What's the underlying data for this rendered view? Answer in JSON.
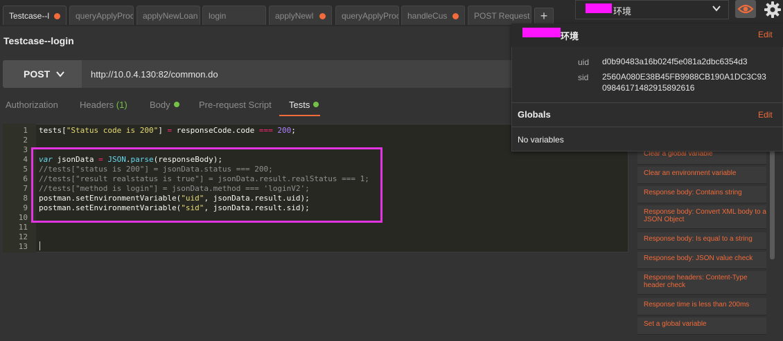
{
  "tabs": [
    {
      "label": "Testcase--l",
      "dot": true,
      "active": true
    },
    {
      "label": "queryApplyProce",
      "dot": false
    },
    {
      "label": "applyNewLoan",
      "dot": false
    },
    {
      "label": "login",
      "dot": false
    },
    {
      "label": "applyNewl",
      "dot": true
    },
    {
      "label": "queryApplyProc",
      "dot": false
    },
    {
      "label": "handleCus",
      "dot": true
    },
    {
      "label": "POST Request",
      "dot": false
    }
  ],
  "add_tab": "+",
  "environment": {
    "selected": "环境"
  },
  "request": {
    "title": "Testcase--login",
    "method": "POST",
    "url": "http://10.0.4.130:82/common.do"
  },
  "subtabs": {
    "authorization": "Authorization",
    "headers": "Headers",
    "headers_count": "(1)",
    "body": "Body",
    "prerequest": "Pre-request Script",
    "tests": "Tests"
  },
  "editor": {
    "line_numbers": [
      "1",
      "2",
      "3",
      "4",
      "5",
      "6",
      "7",
      "8",
      "9",
      "10",
      "11",
      "12",
      "13"
    ]
  },
  "snippets": [
    "Clear a global variable",
    "Clear an environment variable",
    "Response body: Contains string",
    "Response body: Convert XML body to a JSON Object",
    "Response body: Is equal to a string",
    "Response body: JSON value check",
    "Response headers: Content-Type header check",
    "Response time is less than 200ms",
    "Set a global variable"
  ],
  "env_popover": {
    "name": "环境",
    "edit": "Edit",
    "vars": [
      {
        "key": "uid",
        "value": "d0b90483a16b024f5e081a2dbc6354d3"
      },
      {
        "key": "sid",
        "value": "2560A080E38B45FB9988CB190A1DC3C9309846171482915892616"
      }
    ],
    "globals_title": "Globals",
    "globals_edit": "Edit",
    "globals_empty": "No variables"
  },
  "colors": {
    "accent": "#f26b3a",
    "green": "#73c247",
    "highlight": "#e234e0"
  }
}
